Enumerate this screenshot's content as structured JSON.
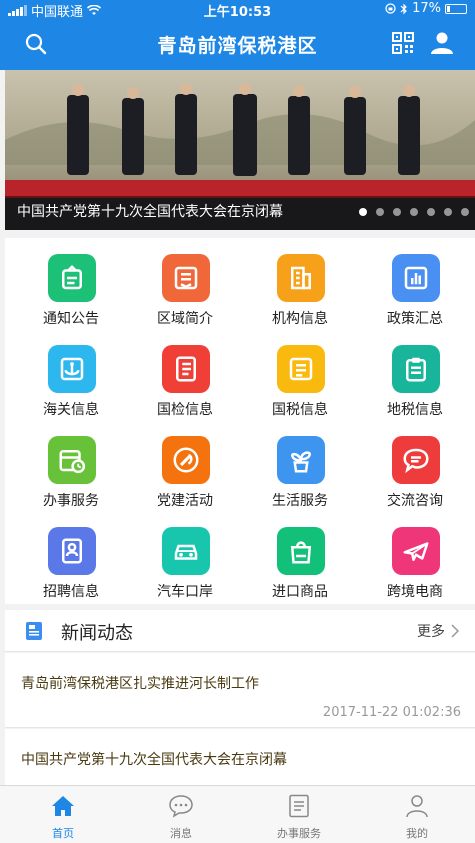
{
  "status_bar": {
    "carrier": "中国联通",
    "time": "上午10:53",
    "battery": "17%"
  },
  "header": {
    "title": "青岛前湾保税港区"
  },
  "banner": {
    "caption": "中国共产党第十九次全国代表大会在京闭幕",
    "slide_count": 7,
    "active_slide": 1
  },
  "grid": [
    {
      "label": "通知公告",
      "icon": "notice-icon",
      "color": "#1dc077"
    },
    {
      "label": "区域简介",
      "icon": "intro-icon",
      "color": "#f0683a"
    },
    {
      "label": "机构信息",
      "icon": "building-icon",
      "color": "#f7a11b"
    },
    {
      "label": "政策汇总",
      "icon": "chart-icon",
      "color": "#4a8ff2"
    },
    {
      "label": "海关信息",
      "icon": "anchor-icon",
      "color": "#2cb7ee"
    },
    {
      "label": "国检信息",
      "icon": "book-icon",
      "color": "#ef3f37"
    },
    {
      "label": "国税信息",
      "icon": "document-icon",
      "color": "#f9b90f"
    },
    {
      "label": "地税信息",
      "icon": "list-doc-icon",
      "color": "#19b59a"
    },
    {
      "label": "办事服务",
      "icon": "calendar-icon",
      "color": "#67c23a"
    },
    {
      "label": "党建活动",
      "icon": "party-icon",
      "color": "#f5730f"
    },
    {
      "label": "生活服务",
      "icon": "plant-icon",
      "color": "#3e95f0"
    },
    {
      "label": "交流咨询",
      "icon": "chat-icon",
      "color": "#ee3b3b"
    },
    {
      "label": "招聘信息",
      "icon": "resume-icon",
      "color": "#5b78e8"
    },
    {
      "label": "汽车口岸",
      "icon": "car-icon",
      "color": "#17c6ad"
    },
    {
      "label": "进口商品",
      "icon": "bag-icon",
      "color": "#12c07a"
    },
    {
      "label": "跨境电商",
      "icon": "plane-icon",
      "color": "#ee3678"
    }
  ],
  "news": {
    "title": "新闻动态",
    "more": "更多",
    "items": [
      {
        "title": "青岛前湾保税港区扎实推进河长制工作",
        "date": "2017-11-22 01:02:36"
      },
      {
        "title": "中国共产党第十九次全国代表大会在京闭幕",
        "date": ""
      }
    ]
  },
  "tabs": [
    {
      "label": "首页",
      "icon": "home-icon"
    },
    {
      "label": "消息",
      "icon": "message-icon"
    },
    {
      "label": "办事服务",
      "icon": "service-icon"
    },
    {
      "label": "我的",
      "icon": "profile-icon"
    }
  ],
  "active_tab": 0,
  "colors": {
    "accent": "#1e87e6",
    "tab_inactive": "#777777"
  }
}
